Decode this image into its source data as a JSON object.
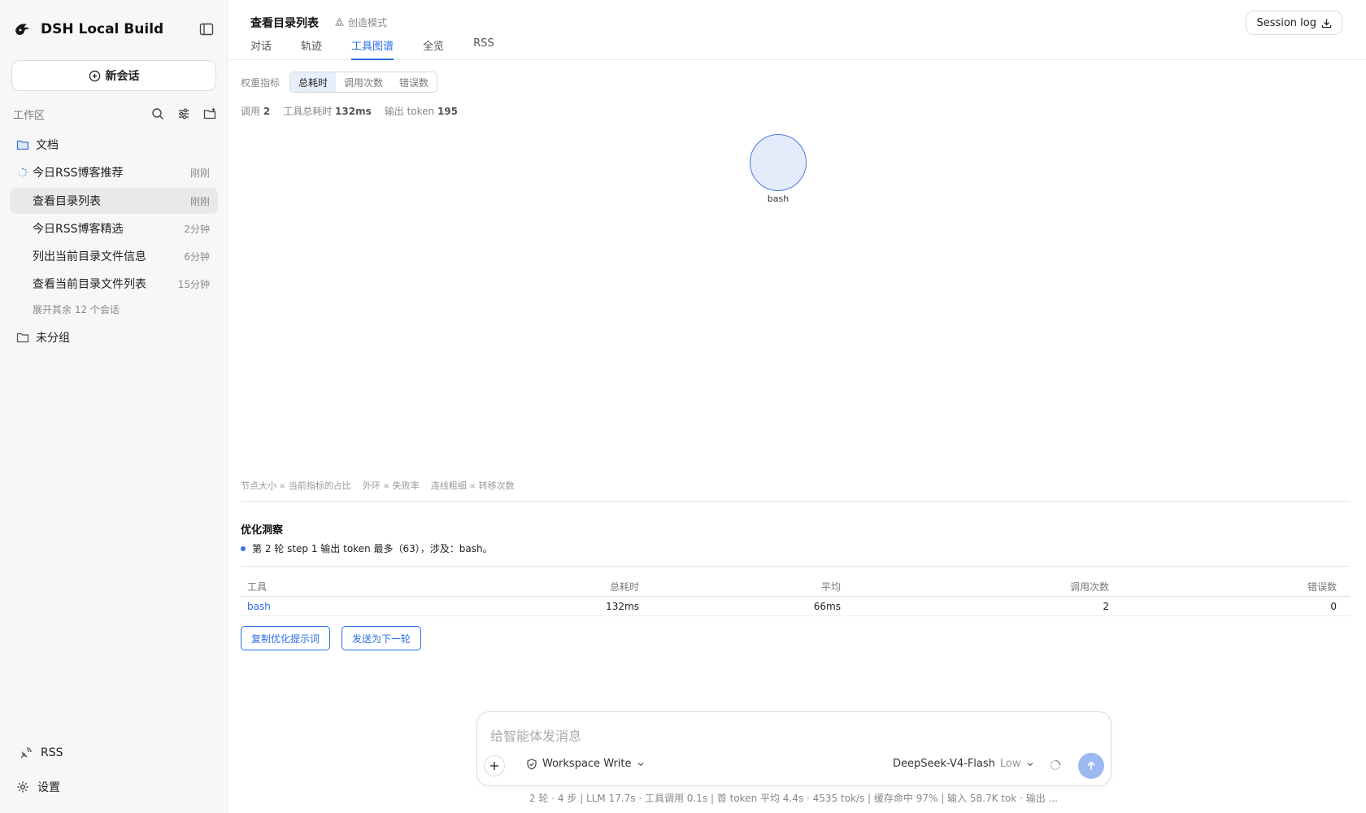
{
  "sidebar": {
    "brand": "DSH Local Build",
    "new_chat": "新会话",
    "workspace_label": "工作区",
    "folder_docs": "文档",
    "sessions": [
      {
        "name": "今日RSS博客推荐",
        "time": "刚刚",
        "loading": true
      },
      {
        "name": "查看目录列表",
        "time": "刚刚",
        "active": true
      },
      {
        "name": "今日RSS博客精选",
        "time": "2分钟"
      },
      {
        "name": "列出当前目录文件信息",
        "time": "6分钟"
      },
      {
        "name": "查看当前目录文件列表",
        "time": "15分钟"
      }
    ],
    "expand_more": "展开其余 12 个会话",
    "folder_ungrouped": "未分组",
    "rss": "RSS",
    "settings": "设置"
  },
  "header": {
    "title": "查看目录列表",
    "mode": "创造模式",
    "tabs": [
      "对话",
      "轨迹",
      "工具图谱",
      "全览",
      "RSS"
    ],
    "active_tab": "工具图谱",
    "session_log": "Session log"
  },
  "graph": {
    "metric_label": "权重指标",
    "metric_options": [
      "总耗时",
      "调用次数",
      "错误数"
    ],
    "metric_active": "总耗时",
    "stats": {
      "calls_label": "调用",
      "calls": "2",
      "tool_time_label": "工具总耗时",
      "tool_time": "132ms",
      "output_label": "输出 token",
      "output": "195"
    },
    "nodes": [
      {
        "name": "bash"
      }
    ],
    "legend": [
      "节点大小 ∝ 当前指标的占比",
      "外环 ∝ 失败率",
      "连线粗细 ∝ 转移次数"
    ]
  },
  "insights": {
    "title": "优化洞察",
    "items": [
      "第 2 轮 step 1 输出 token 最多（63），涉及：bash。"
    ]
  },
  "table": {
    "headers": [
      "工具",
      "总耗时",
      "平均",
      "调用次数",
      "错误数"
    ],
    "rows": [
      {
        "tool": "bash",
        "total": "132ms",
        "avg": "66ms",
        "calls": "2",
        "errors": "0"
      }
    ]
  },
  "actions": {
    "copy_prompt": "复制优化提示词",
    "send_next": "发送为下一轮"
  },
  "composer": {
    "placeholder": "给智能体发消息",
    "permission": "Workspace Write",
    "model": "DeepSeek-V4-Flash",
    "effort": "Low"
  },
  "footer": {
    "text": "2 轮 · 4 步   |   LLM 17.7s · 工具调用 0.1s   |   首 token 平均 4.4s · 4535 tok/s   |   缓存命中 97%   |   输入 58.7K tok · 输出 ..."
  },
  "colors": {
    "accent": "#2b6ee5",
    "node_fill": "#e4ebfb",
    "node_stroke": "#4e7ae0",
    "sidebar_bg": "#f7f7f7"
  }
}
